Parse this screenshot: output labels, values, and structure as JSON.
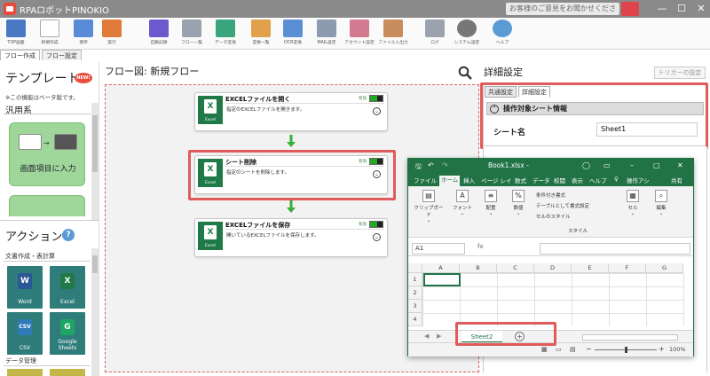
{
  "app": {
    "title": "RPAロボットPINOKIO",
    "feedback": "お客様のご意見をお聞かせください",
    "window_controls": [
      "—",
      "☐",
      "✕"
    ]
  },
  "toolbar": [
    {
      "label": "TOP画面",
      "icon": "home-icon",
      "color": "#4a78c2"
    },
    {
      "label": "新規作成",
      "icon": "new-file-icon",
      "color": "#e8e8e8"
    },
    {
      "label": "保存",
      "icon": "save-icon",
      "color": "#5a8bd6"
    },
    {
      "label": "実行",
      "icon": "play-icon",
      "color": "#e07b39"
    },
    {
      "label": "自動記録",
      "icon": "record-icon",
      "color": "#6a5acd"
    },
    {
      "label": "フロー一覧",
      "icon": "flow-list-icon",
      "color": "#9aa3ad"
    },
    {
      "label": "データ変換",
      "icon": "data-convert-icon",
      "color": "#3aa57c"
    },
    {
      "label": "変数一覧",
      "icon": "variable-list-icon",
      "color": "#e1a04a"
    },
    {
      "label": "OCR変換",
      "icon": "ocr-icon",
      "color": "#5b8fd3"
    },
    {
      "label": "MAIL設定",
      "icon": "mail-icon",
      "color": "#8c9bb0"
    },
    {
      "label": "アカウント設定",
      "icon": "account-icon",
      "color": "#d27a8f"
    },
    {
      "label": "ファイル入出力",
      "icon": "file-io-icon",
      "color": "#c98c5c"
    },
    {
      "label": "ログ",
      "icon": "log-icon",
      "color": "#9aa3ad"
    },
    {
      "label": "システム設定",
      "icon": "gear-icon",
      "color": "#777777"
    },
    {
      "label": "ヘルプ",
      "icon": "help-icon",
      "color": "#5b9bd5"
    }
  ],
  "tabs": [
    "フロー作成",
    "フロー設定"
  ],
  "left_panel": {
    "template_title": "テンプレート",
    "new_badge": "NEW!",
    "beta_note": "※この機能はベータ版です。",
    "category": "汎用系",
    "template_card_label": "画面項目に入力",
    "action_title": "アクション",
    "action_help": "?",
    "doc_category": "文書作成・表計算",
    "actions": [
      {
        "label": "Word",
        "logo": "W",
        "logo_color": "#2b5797"
      },
      {
        "label": "Excel",
        "logo": "X",
        "logo_color": "#1f7a48"
      },
      {
        "label": "CSV",
        "logo": "CSV",
        "logo_color": "#2f7ab9"
      },
      {
        "label": "Google Sheets",
        "logo": "G",
        "logo_color": "#1fa463"
      }
    ],
    "data_category": "データ管理"
  },
  "flow": {
    "title": "フロー図:  新規フロー",
    "nodes": [
      {
        "title": "EXCELファイルを開く",
        "desc": "指定のEXCELファイルを開きます。",
        "enabled": "有効",
        "icon_label": "Excel"
      },
      {
        "title": "シート削除",
        "desc": "指定のシートを削除します。",
        "enabled": "有効",
        "icon_label": "Excel"
      },
      {
        "title": "EXCELファイルを保存",
        "desc": "開いているEXCELファイルを保存します。",
        "enabled": "有効",
        "icon_label": "Excel"
      }
    ]
  },
  "detail": {
    "title": "詳細設定",
    "trigger_button": "トリガーの設定",
    "tabs": [
      "共通設定",
      "詳細設定"
    ],
    "section": "操作対象シート情報",
    "field_label": "シート名",
    "field_value": "Sheet1"
  },
  "excel": {
    "filename": "Book1.xlsx  -",
    "ribbon_tabs": [
      "ファイル",
      "ホーム",
      "挿入",
      "ページ レイ",
      "数式",
      "データ",
      "校閲",
      "表示",
      "ヘルプ",
      "♀",
      "操作アシ",
      "共有"
    ],
    "groups": [
      "クリップボード",
      "フォント",
      "配置",
      "数値",
      "セル",
      "編集"
    ],
    "style_items": [
      "条件付き書式",
      "テーブルとして書式設定",
      "セルのスタイル"
    ],
    "style_group": "スタイル",
    "name_box": "A1",
    "fx": "fx",
    "columns": [
      "A",
      "B",
      "C",
      "D",
      "E",
      "F",
      "G"
    ],
    "rows": [
      "1",
      "2",
      "3",
      "4"
    ],
    "sheet": "Sheet2",
    "zoom": "100%"
  }
}
